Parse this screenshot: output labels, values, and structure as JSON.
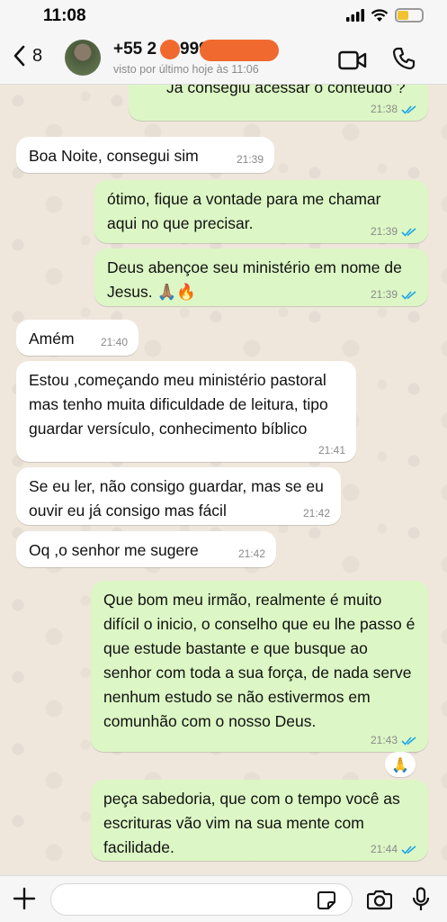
{
  "status_bar": {
    "time": "11:08",
    "battery_level": 0.45
  },
  "header": {
    "back_count": "8",
    "contact_name": "+55 2",
    "contact_name_suffix": "999",
    "contact_status": "visto por último hoje às 11:06"
  },
  "messages": [
    {
      "direction": "out",
      "text": "Já consegiu acessar o conteúdo ?",
      "time": "21:38",
      "read": true
    },
    {
      "direction": "in",
      "text": "Boa Noite, consegui sim",
      "time": "21:39"
    },
    {
      "direction": "out",
      "text": "ótimo, fique a vontade para me chamar aqui no que precisar.",
      "time": "21:39",
      "read": true
    },
    {
      "direction": "out",
      "text": "Deus abençoe seu ministério em nome de Jesus. 🙏🏽🔥",
      "time": "21:39",
      "read": true
    },
    {
      "direction": "in",
      "text": "Amém",
      "time": "21:40"
    },
    {
      "direction": "in",
      "text": "Estou ,começando meu ministério pastoral mas tenho muita dificuldade de leitura, tipo guardar versículo, conhecimento bíblico",
      "time": "21:41"
    },
    {
      "direction": "in",
      "text": "Se eu ler, não consigo guardar, mas se eu ouvir eu já consigo mas fácil",
      "time": "21:42"
    },
    {
      "direction": "in",
      "text": "Oq ,o senhor me sugere",
      "time": "21:42"
    },
    {
      "direction": "out",
      "text": "Que bom meu irmão, realmente é muito difícil o inicio, o conselho que eu lhe passo é que estude bastante e que busque ao senhor com toda a sua força, de nada serve nenhum estudo se não estivermos em comunhão com o nosso Deus.",
      "time": "21:43",
      "read": true,
      "reaction": "🙏"
    },
    {
      "direction": "out",
      "text": "peça sabedoria, que com o tempo você as escrituras vão vim na sua mente com facilidade.",
      "time": "21:44",
      "read": true
    }
  ],
  "input": {
    "placeholder": ""
  },
  "colors": {
    "outgoing": "#dcf7c5",
    "incoming": "#ffffff",
    "accent": "#1ea5e9",
    "background": "#efe7dc"
  }
}
